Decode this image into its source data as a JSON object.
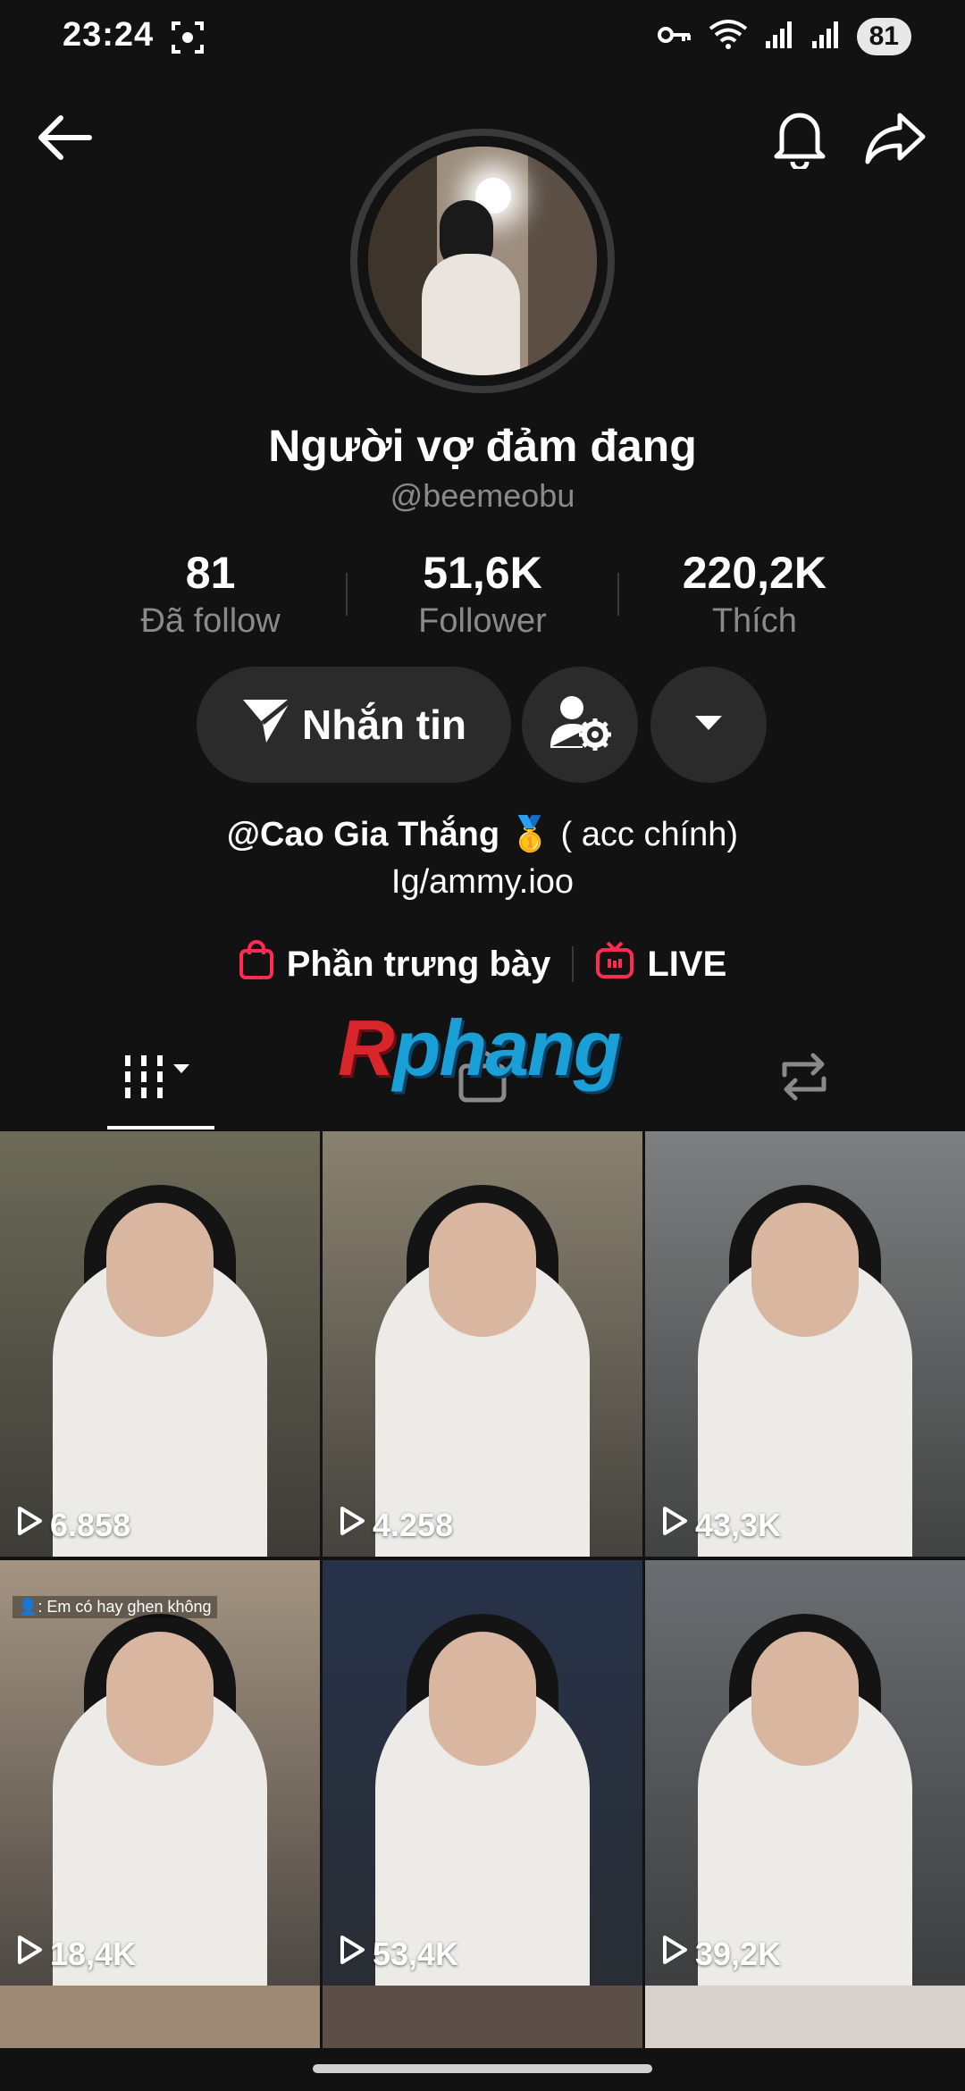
{
  "status_bar": {
    "time": "23:24",
    "battery": "81"
  },
  "profile": {
    "display_name": "Người vợ đảm đang",
    "username": "@beemeobu",
    "stats": [
      {
        "value": "81",
        "label": "Đã follow"
      },
      {
        "value": "51,6K",
        "label": "Follower"
      },
      {
        "value": "220,2K",
        "label": "Thích"
      }
    ],
    "message_button": "Nhắn tin",
    "bio_mention": "@Cao Gia Thắng",
    "bio_emoji": "🥇",
    "bio_suffix": " ( acc chính)",
    "bio_line2": "Ig/ammy.ioo"
  },
  "links": {
    "showcase": "Phần trưng bày",
    "live": "LIVE",
    "accent": "#fe2c55"
  },
  "watermark": {
    "first": "R",
    "rest": "phang"
  },
  "videos": [
    {
      "views": "6.858",
      "bg": "#6d6a58"
    },
    {
      "views": "4.258",
      "bg": "#8a8270"
    },
    {
      "views": "43,3K",
      "bg": "#7d7f80"
    },
    {
      "views": "18,4K",
      "bg": "#a49482",
      "caption": "👤: Em có hay ghen không"
    },
    {
      "views": "53,4K",
      "bg": "#27334a"
    },
    {
      "views": "39,2K",
      "bg": "#6a6e72"
    }
  ],
  "colors": {
    "background": "#121212",
    "button_bg": "#2b2b2b",
    "muted_text": "#8a8a8a"
  }
}
